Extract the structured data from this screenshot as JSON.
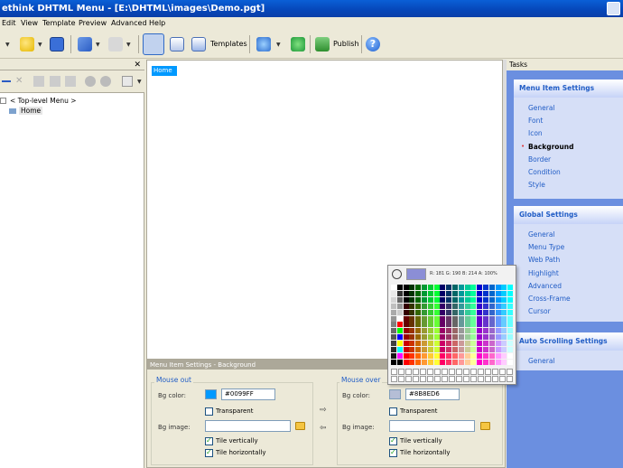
{
  "window": {
    "title": "ethink DHTML Menu - [E:\\DHTML\\images\\Demo.pgt]"
  },
  "menubar": [
    "Edit",
    "View",
    "Template",
    "Preview",
    "Advanced",
    "Help"
  ],
  "toolbar": {
    "templates_label": "Templates",
    "publish_label": "Publish"
  },
  "icons": [
    "new-icon",
    "open-icon",
    "save-icon",
    "undo-icon",
    "redo-icon",
    "layout-icon",
    "properties-icon",
    "templates-icon",
    "preview-icon",
    "refresh-icon",
    "publish-icon",
    "help-icon"
  ],
  "tree": {
    "root": "< Top-level Menu >",
    "child": "Home"
  },
  "canvas": {
    "home_item": "Home"
  },
  "bottom": {
    "header": "Menu Item Settings - Background",
    "mouse_out": {
      "title": "Mouse out",
      "bg_color_label": "Bg color:",
      "bg_color_value": "#0099FF",
      "transparent_label": "Transparent",
      "bg_image_label": "Bg image:",
      "tile_v": "Tile vertically",
      "tile_h": "Tile horizontally"
    },
    "mouse_over": {
      "title": "Mouse over",
      "bg_color_label": "Bg color:",
      "bg_color_value": "#8B8ED6",
      "transparent_label": "Transparent",
      "bg_image_label": "Bg image:",
      "tile_v": "Tile vertically",
      "tile_h": "Tile horizontally"
    }
  },
  "tasks": {
    "title": "Tasks",
    "menu_item_settings": {
      "title": "Menu Item Settings",
      "links": [
        "General",
        "Font",
        "Icon",
        "Background",
        "Border",
        "Condition",
        "Style"
      ],
      "selected": "Background"
    },
    "global_settings": {
      "title": "Global Settings",
      "links": [
        "General",
        "Menu Type",
        "Web Path",
        "Highlight",
        "Advanced",
        "Cross-Frame",
        "Cursor"
      ]
    },
    "auto_scrolling": {
      "title": "Auto Scrolling Settings",
      "links": [
        "General"
      ]
    }
  },
  "picker": {
    "info": "R: 181  G: 190  B: 214  A: 100%"
  },
  "colors": {
    "mouse_out_swatch": "#0099FF",
    "mouse_over_swatch": "#B5BED6",
    "accent": "#215DC6"
  }
}
